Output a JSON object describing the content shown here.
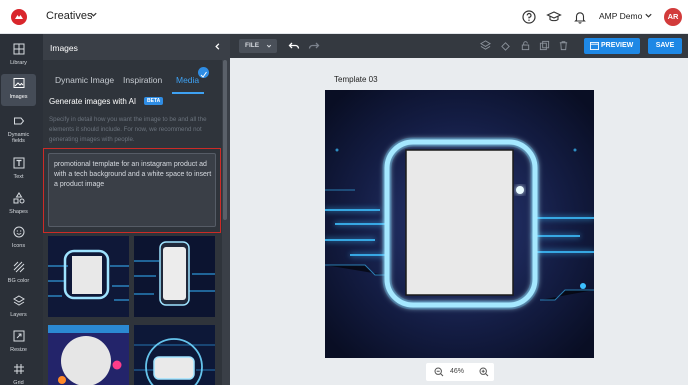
{
  "header": {
    "app_name": "Creatives",
    "account_name": "AMP Demo",
    "avatar_initials": "AR",
    "brand_color": "#d9262c"
  },
  "rail": {
    "items": [
      {
        "label": "Library",
        "icon": "library-icon"
      },
      {
        "label": "Images",
        "icon": "images-icon",
        "active": true
      },
      {
        "label": "Dynamic fields",
        "icon": "dynamic-fields-icon"
      },
      {
        "label": "Text",
        "icon": "text-icon"
      },
      {
        "label": "Shapes",
        "icon": "shapes-icon"
      },
      {
        "label": "Icons",
        "icon": "smiley-icon"
      },
      {
        "label": "BG color",
        "icon": "bg-color-icon"
      },
      {
        "label": "Layers",
        "icon": "layers-icon"
      },
      {
        "label": "Resize",
        "icon": "resize-icon"
      },
      {
        "label": "Grid",
        "icon": "grid-icon"
      }
    ]
  },
  "panel": {
    "title": "Images",
    "tabs": [
      {
        "label": "Dynamic Image"
      },
      {
        "label": "Inspiration"
      },
      {
        "label": "Media",
        "active": true
      }
    ],
    "generate_title": "Generate images with AI",
    "beta_label": "BETA",
    "hint": "Specify in detail how you want the image to be and all the elements it should include. For now, we recommend not generating images with people.",
    "prompt_value": "promotional template for an instagram product ad with a tech background and a white space to insert a product image",
    "accent_color": "#3ea1f2",
    "highlight_color": "#cc2b27"
  },
  "toolbar": {
    "file_label": "FILE",
    "preview_label": "PREVIEW",
    "save_label": "SAVE"
  },
  "canvas": {
    "template_name": "Template 03",
    "zoom": "46%"
  }
}
